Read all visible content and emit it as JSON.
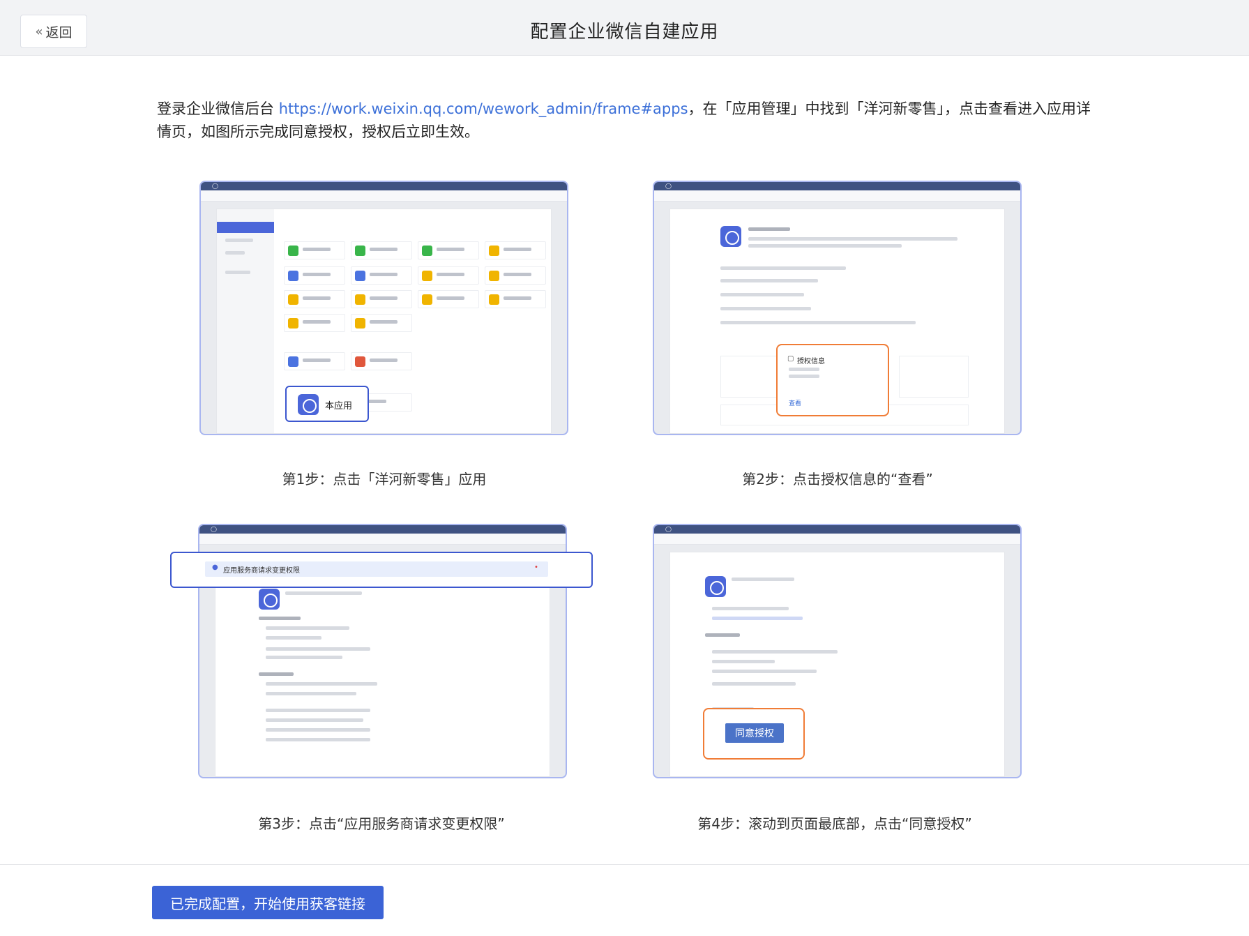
{
  "header": {
    "back_label": "返回",
    "title": "配置企业微信自建应用"
  },
  "intro": {
    "before": "登录企业微信后台 ",
    "link": "https://work.weixin.qq.com/wework_admin/frame#apps",
    "after": "，在「应用管理」中找到「洋河新零售」，点击查看进入应用详情页，如图所示完成同意授权，授权后立即生效。"
  },
  "steps": [
    {
      "caption": "第1步：点击「洋河新零售」应用",
      "callout": "本应用"
    },
    {
      "caption": "第2步：点击授权信息的“查看”",
      "callout_title": "授权信息",
      "callout_link": "查看"
    },
    {
      "caption": "第3步：点击“应用服务商请求变更权限”",
      "callout": "应用服务商请求变更权限"
    },
    {
      "caption": "第4步：滚动到页面最底部，点击“同意授权”",
      "callout": "同意授权"
    }
  ],
  "footer": {
    "primary_button": "已完成配置，开始使用获客链接"
  },
  "colors": {
    "primary": "#3b63d6",
    "link": "#3b6fd8",
    "highlight_orange": "#f07c36",
    "highlight_blue": "#3c57cf"
  }
}
